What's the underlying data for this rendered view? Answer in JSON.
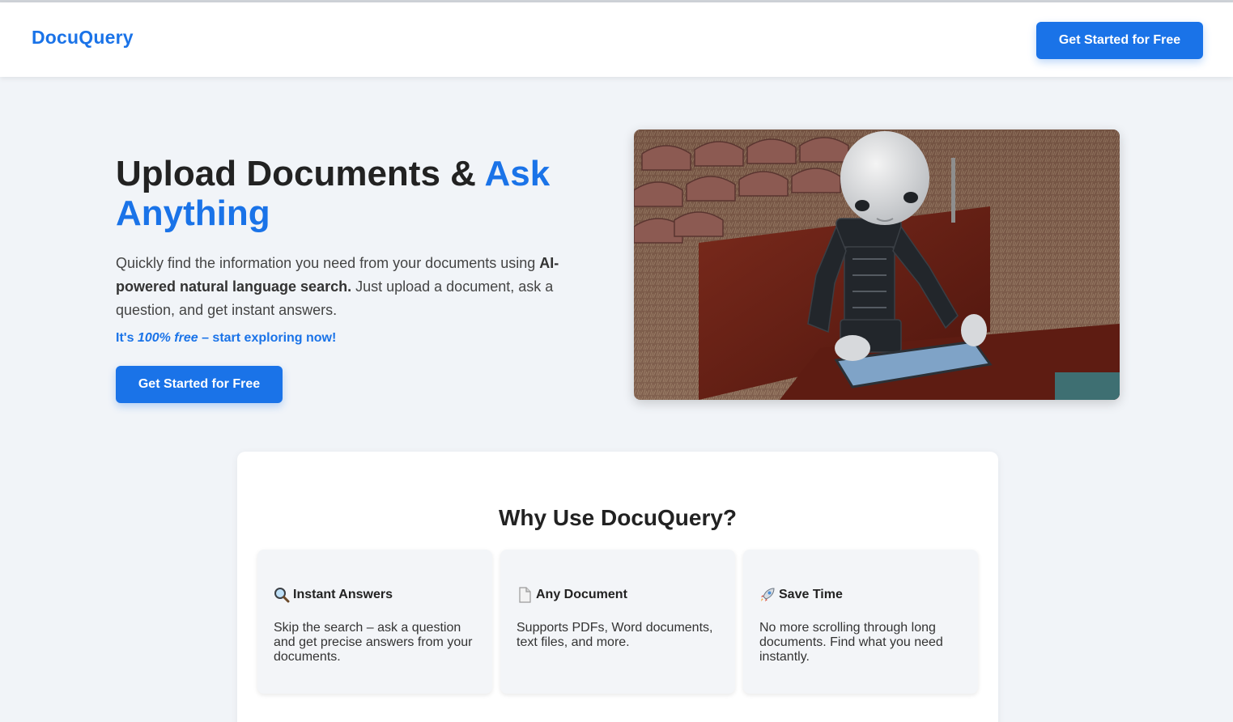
{
  "nav": {
    "logo": "DocuQuery",
    "cta_label": "Get Started for Free"
  },
  "hero": {
    "title_main": "Upload Documents & ",
    "title_accent": "Ask Anything",
    "desc_pre": "Quickly find the information you need from your documents using ",
    "desc_bold": "AI-powered natural language search.",
    "desc_post": " Just upload a document, ask a question, and get instant answers.",
    "free_pre": "It's ",
    "free_em": "100% free",
    "free_post": " – start exploring now!",
    "cta_label": "Get Started for Free",
    "image_alt": "Robot reading a tablet on a bench"
  },
  "features": {
    "title": "Why Use DocuQuery?",
    "items": [
      {
        "icon": "magnifier-icon",
        "title": "Instant Answers",
        "text": "Skip the search – ask a question and get precise answers from your documents."
      },
      {
        "icon": "document-icon",
        "title": "Any Document",
        "text": "Supports PDFs, Word documents, text files, and more."
      },
      {
        "icon": "rocket-icon",
        "title": "Save Time",
        "text": "No more scrolling through long documents. Find what you need instantly."
      }
    ]
  },
  "colors": {
    "brand": "#1a73e8",
    "background": "#f1f4f8"
  }
}
